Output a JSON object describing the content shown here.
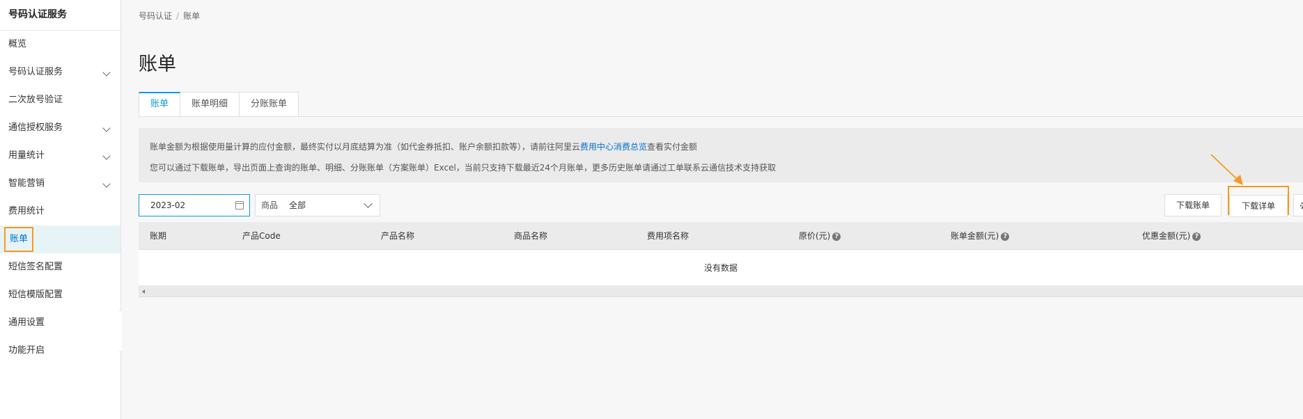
{
  "sidebar": {
    "title": "号码认证服务",
    "items": [
      {
        "label": "概览",
        "expandable": false
      },
      {
        "label": "号码认证服务",
        "expandable": true
      },
      {
        "label": "二次放号验证",
        "expandable": false
      },
      {
        "label": "通信授权服务",
        "expandable": true
      },
      {
        "label": "用量统计",
        "expandable": true
      },
      {
        "label": "智能营销",
        "expandable": true
      },
      {
        "label": "费用统计",
        "expandable": false
      },
      {
        "label": "账单",
        "expandable": false,
        "active": true
      },
      {
        "label": "短信签名配置",
        "expandable": false
      },
      {
        "label": "短信模版配置",
        "expandable": false
      },
      {
        "label": "通用设置",
        "expandable": false
      },
      {
        "label": "功能开启",
        "expandable": false
      }
    ],
    "collapse_glyph": "«"
  },
  "breadcrumb": {
    "root": "号码认证",
    "separator": "/",
    "current": "账单"
  },
  "page_title": "账单",
  "tabs": [
    {
      "label": "账单",
      "active": true
    },
    {
      "label": "账单明细",
      "active": false
    },
    {
      "label": "分账账单",
      "active": false
    }
  ],
  "notice": {
    "line1_before": "账单金额为根据使用量计算的应付金额，最终实付以月底结算为准（如代金券抵扣、账户余额扣款等），请前往阿里云",
    "line1_link": "费用中心消费总览",
    "line1_after": "查看实付金额",
    "line2": "您可以通过下载账单，导出页面上查询的账单、明细、分账账单（方案账单）Excel，当前只支持下载最近24个月账单，更多历史账单请通过工单联系云通信技术支持获取"
  },
  "filters": {
    "date_value": "2023-02",
    "product_label": "商品",
    "product_value": "全部"
  },
  "buttons": {
    "download_bill": "下载账单",
    "download_detail": "下载详单"
  },
  "table": {
    "columns": [
      {
        "label": "账期",
        "help": false
      },
      {
        "label": "产品Code",
        "help": false
      },
      {
        "label": "产品名称",
        "help": false
      },
      {
        "label": "商品名称",
        "help": false
      },
      {
        "label": "费用项名称",
        "help": false
      },
      {
        "label": "原价(元)",
        "help": true
      },
      {
        "label": "账单金额(元)",
        "help": true
      },
      {
        "label": "优惠金额(元)",
        "help": true
      }
    ],
    "empty_text": "没有数据"
  },
  "colors": {
    "accent": "#0d9bd7",
    "link": "#0070cc",
    "highlight": "#f7981f"
  }
}
